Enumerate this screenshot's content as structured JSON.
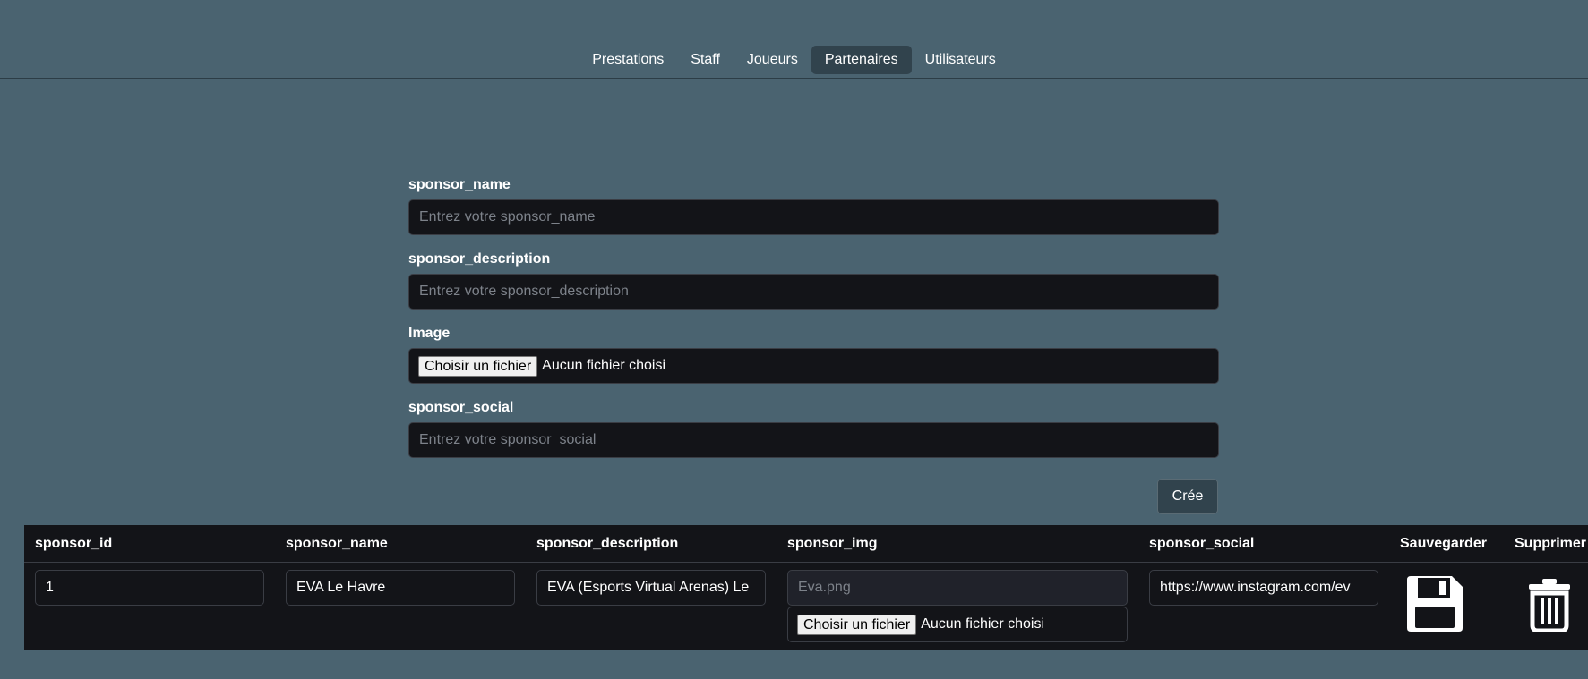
{
  "nav": {
    "items": [
      {
        "label": "Prestations",
        "active": false
      },
      {
        "label": "Staff",
        "active": false
      },
      {
        "label": "Joueurs",
        "active": false
      },
      {
        "label": "Partenaires",
        "active": true
      },
      {
        "label": "Utilisateurs",
        "active": false
      }
    ]
  },
  "form": {
    "name_label": "sponsor_name",
    "name_placeholder": "Entrez votre sponsor_name",
    "description_label": "sponsor_description",
    "description_placeholder": "Entrez votre sponsor_description",
    "image_label": "Image",
    "file_button": "Choisir un fichier",
    "file_none": "Aucun fichier choisi",
    "social_label": "sponsor_social",
    "social_placeholder": "Entrez votre sponsor_social",
    "create_button": "Crée"
  },
  "table": {
    "headers": [
      "sponsor_id",
      "sponsor_name",
      "sponsor_description",
      "sponsor_img",
      "sponsor_social",
      "Sauvegarder",
      "Supprimer"
    ],
    "rows": [
      {
        "id": "1",
        "name": "EVA Le Havre",
        "description": "EVA (Esports Virtual Arenas) Le",
        "img": "Eva.png",
        "file_button": "Choisir un fichier",
        "file_none": "Aucun fichier choisi",
        "social": "https://www.instagram.com/ev"
      }
    ]
  },
  "icons": {
    "save": "floppy-disk-icon",
    "delete": "trash-icon"
  }
}
